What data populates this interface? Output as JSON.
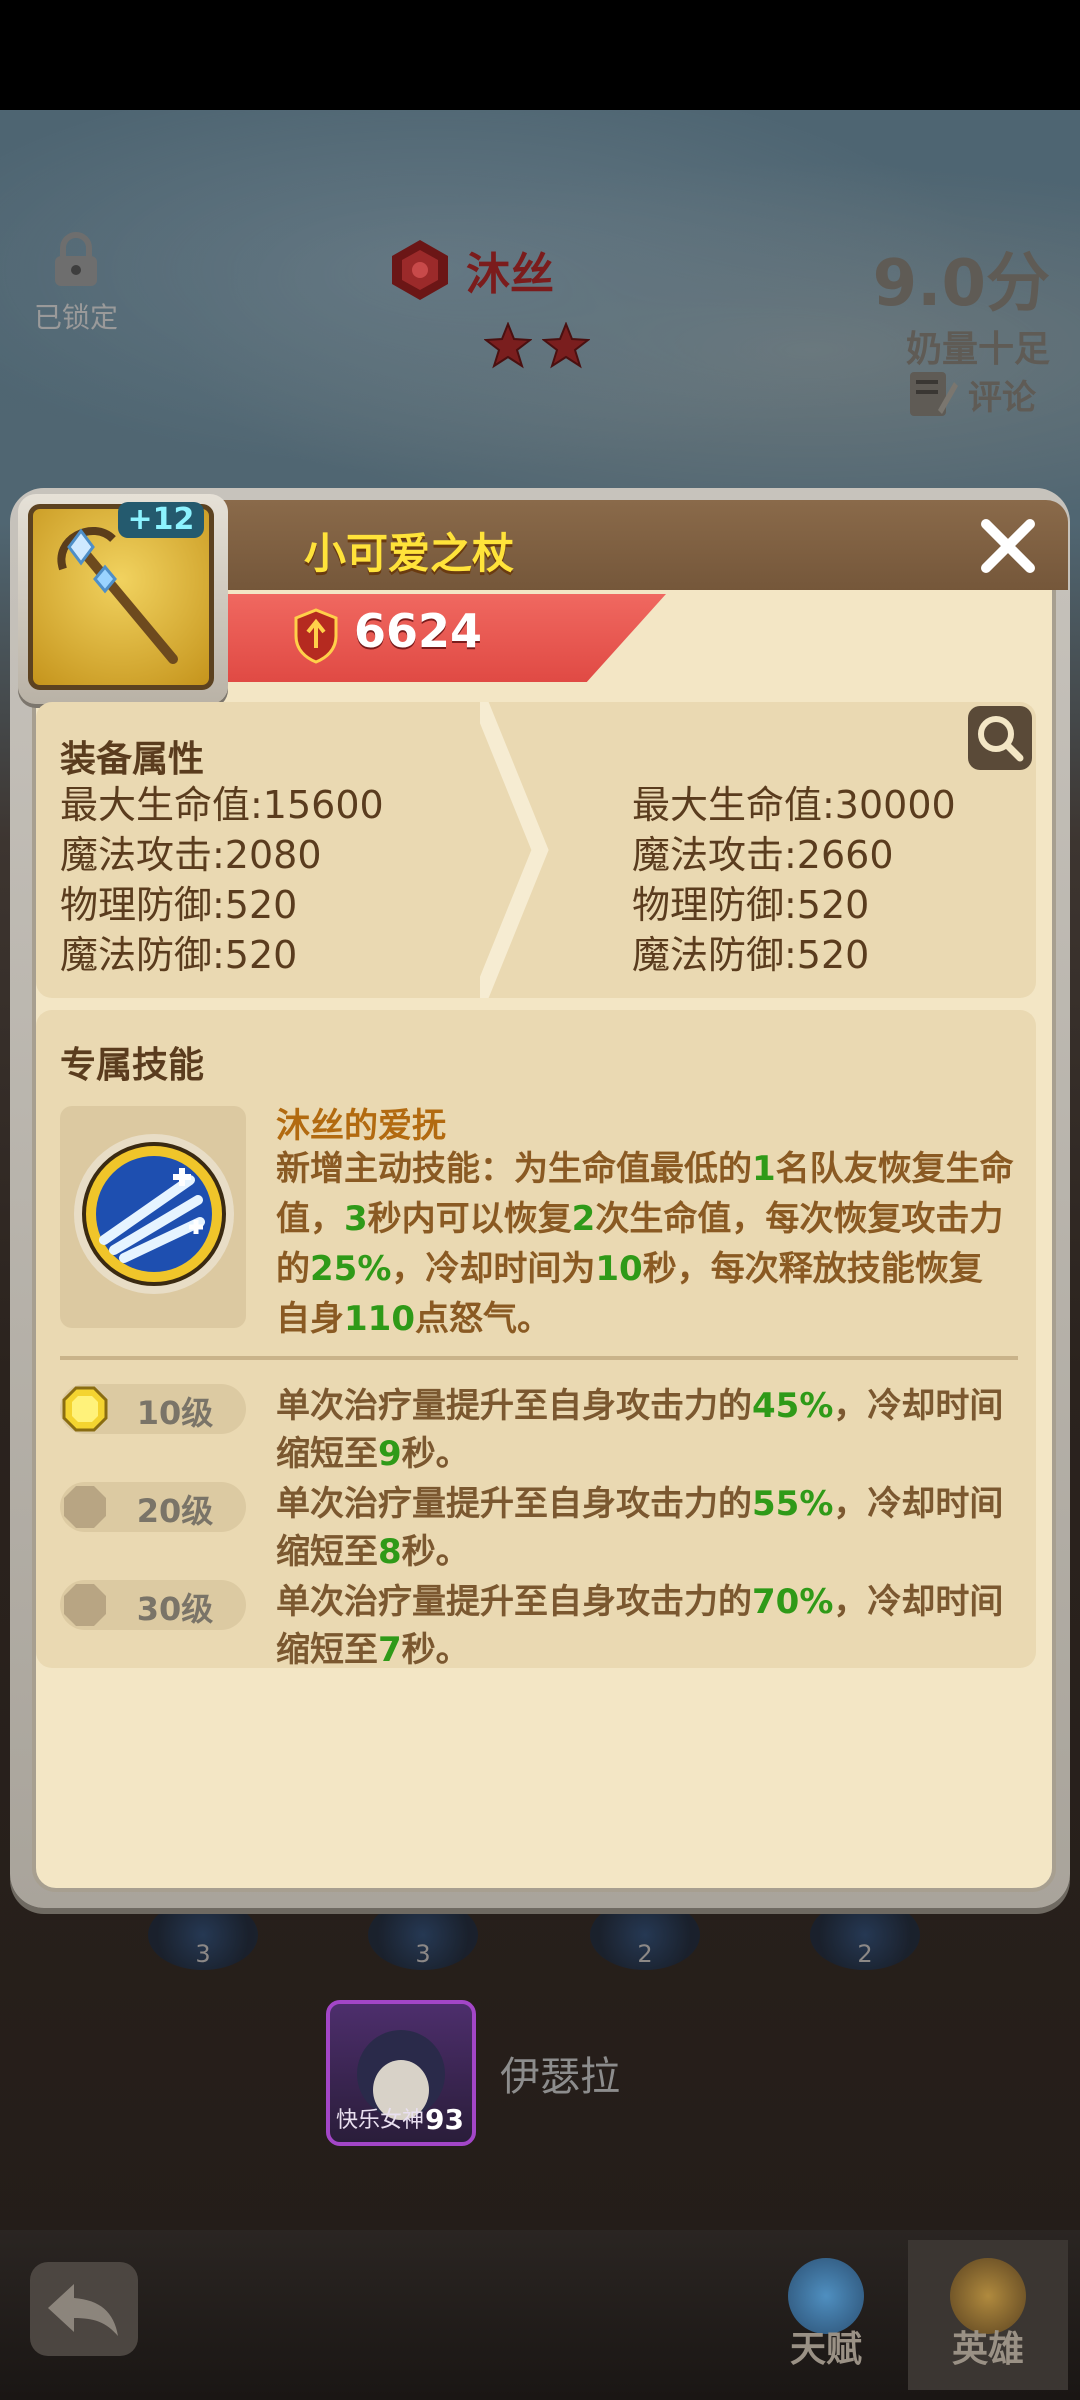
{
  "hero": {
    "lock_label": "已锁定",
    "name": "沐丝",
    "stars": 2,
    "score": "9.0分",
    "score_sub": "奶量十足",
    "comment_label": "评论"
  },
  "item": {
    "name": "小可爱之杖",
    "level": "+12",
    "power": "6624"
  },
  "attributes": {
    "title": "装备属性",
    "current": [
      "最大生命值:15600",
      "魔法攻击:2080",
      "物理防御:520",
      "魔法防御:520"
    ],
    "next": [
      "最大生命值:30000",
      "魔法攻击:2660",
      "物理防御:520",
      "魔法防御:520"
    ]
  },
  "skill": {
    "header": "专属技能",
    "name": "沐丝的爱抚",
    "desc_parts": [
      {
        "t": "新增主动技能：为生命值最低的",
        "g": false
      },
      {
        "t": "1",
        "g": true
      },
      {
        "t": "名队友恢复生命值，",
        "g": false
      },
      {
        "t": "3",
        "g": true
      },
      {
        "t": "秒内可以恢复",
        "g": false
      },
      {
        "t": "2",
        "g": true
      },
      {
        "t": "次生命值，每次恢复攻击力的",
        "g": false
      },
      {
        "t": "25%",
        "g": true
      },
      {
        "t": "，冷却时间为",
        "g": false
      },
      {
        "t": "10",
        "g": true
      },
      {
        "t": "秒，每次释放技能恢复自身",
        "g": false
      },
      {
        "t": "110",
        "g": true
      },
      {
        "t": "点怒气。",
        "g": false
      }
    ],
    "levels": [
      {
        "label": "10级",
        "active": true,
        "pre": "单次治疗量提升至自身攻击力的",
        "pct": "45%",
        "mid": "，冷却时间缩短至",
        "sec": "9",
        "post": "秒。"
      },
      {
        "label": "20级",
        "active": false,
        "pre": "单次治疗量提升至自身攻击力的",
        "pct": "55%",
        "mid": "，冷却时间缩短至",
        "sec": "8",
        "post": "秒。"
      },
      {
        "label": "30级",
        "active": false,
        "pre": "单次治疗量提升至自身攻击力的",
        "pct": "70%",
        "mid": "，冷却时间缩短至",
        "sec": "7",
        "post": "秒。"
      }
    ]
  },
  "background": {
    "icon_counts": [
      "3",
      "3",
      "2",
      "2"
    ],
    "friend_level": "93",
    "friend_tag": "快乐女神",
    "friend_name": "伊瑟拉",
    "tab_talent": "天赋",
    "tab_hero": "英雄"
  },
  "colors": {
    "accent_green": "#2f9a18",
    "item_name": "#ffe33a",
    "power_strip": "#e04a44"
  }
}
